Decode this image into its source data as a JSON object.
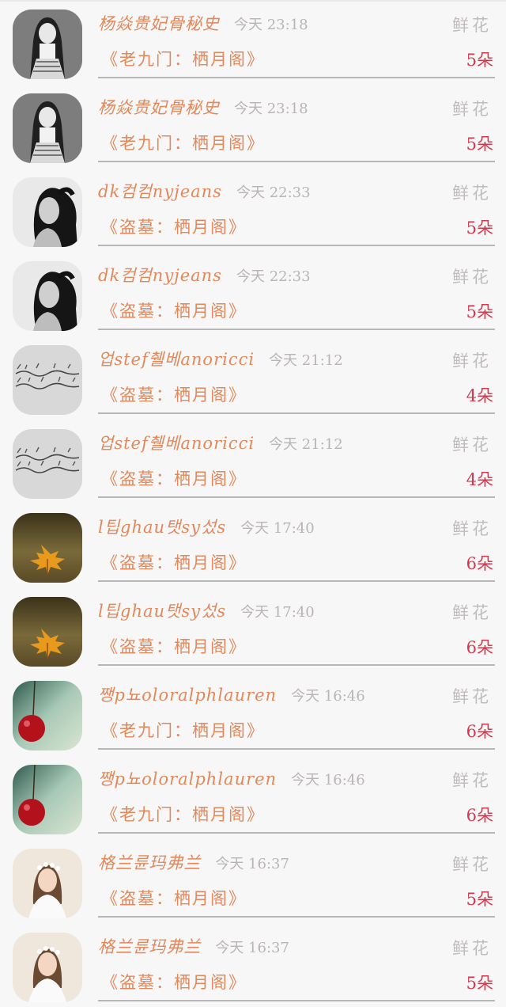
{
  "items": [
    {
      "name": "杨焱贵妃骨秘史",
      "time": "今天 23:18",
      "gift_type": "鲜花",
      "source": "《老九门：栖月阁》",
      "count": "5朵",
      "avatar": "girl-bw-icon"
    },
    {
      "name": "杨焱贵妃骨秘史",
      "time": "今天 23:18",
      "gift_type": "鲜花",
      "source": "《老九门：栖月阁》",
      "count": "5朵",
      "avatar": "girl-bw-icon"
    },
    {
      "name": "dk컴컴nyjeans",
      "time": "今天 22:33",
      "gift_type": "鲜花",
      "source": "《盗墓：栖月阁》",
      "count": "5朵",
      "avatar": "woman-hair-icon"
    },
    {
      "name": "dk컴컴nyjeans",
      "time": "今天 22:33",
      "gift_type": "鲜花",
      "source": "《盗墓：栖月阁》",
      "count": "5朵",
      "avatar": "woman-hair-icon"
    },
    {
      "name": "업stef췔베anoricci",
      "time": "今天 21:12",
      "gift_type": "鲜花",
      "source": "《盗墓：栖月阁》",
      "count": "4朵",
      "avatar": "handwriting-icon"
    },
    {
      "name": "업stef췔베anoricci",
      "time": "今天 21:12",
      "gift_type": "鲜花",
      "source": "《盗墓：栖月阁》",
      "count": "4朵",
      "avatar": "handwriting-icon"
    },
    {
      "name": "l팁ghau탯sy섰s",
      "time": "今天 17:40",
      "gift_type": "鲜花",
      "source": "《盗墓：栖月阁》",
      "count": "6朵",
      "avatar": "maple-leaf-icon"
    },
    {
      "name": "l팁ghau탯sy섰s",
      "time": "今天 17:40",
      "gift_type": "鲜花",
      "source": "《盗墓：栖月阁》",
      "count": "6朵",
      "avatar": "maple-leaf-icon"
    },
    {
      "name": "쨍p뇨oloralphlauren",
      "time": "今天 16:46",
      "gift_type": "鲜花",
      "source": "《老九门：栖月阁》",
      "count": "6朵",
      "avatar": "cherry-icon"
    },
    {
      "name": "쨍p뇨oloralphlauren",
      "time": "今天 16:46",
      "gift_type": "鲜花",
      "source": "《老九门：栖月阁》",
      "count": "6朵",
      "avatar": "cherry-icon"
    },
    {
      "name": "格兰륜玛弗兰",
      "time": "今天 16:37",
      "gift_type": "鲜花",
      "source": "《盗墓：栖月阁》",
      "count": "5朵",
      "avatar": "flower-girl-icon"
    },
    {
      "name": "格兰륜玛弗兰",
      "time": "今天 16:37",
      "gift_type": "鲜花",
      "source": "《盗墓：栖月阁》",
      "count": "5朵",
      "avatar": "flower-girl-icon"
    }
  ],
  "colors": {
    "name": "#e2885a",
    "time": "#b9b4b6",
    "gift_type": "#c0bcbd",
    "count": "#d6374c",
    "divider": "#b9b6b8",
    "background": "#f8f7f8"
  }
}
